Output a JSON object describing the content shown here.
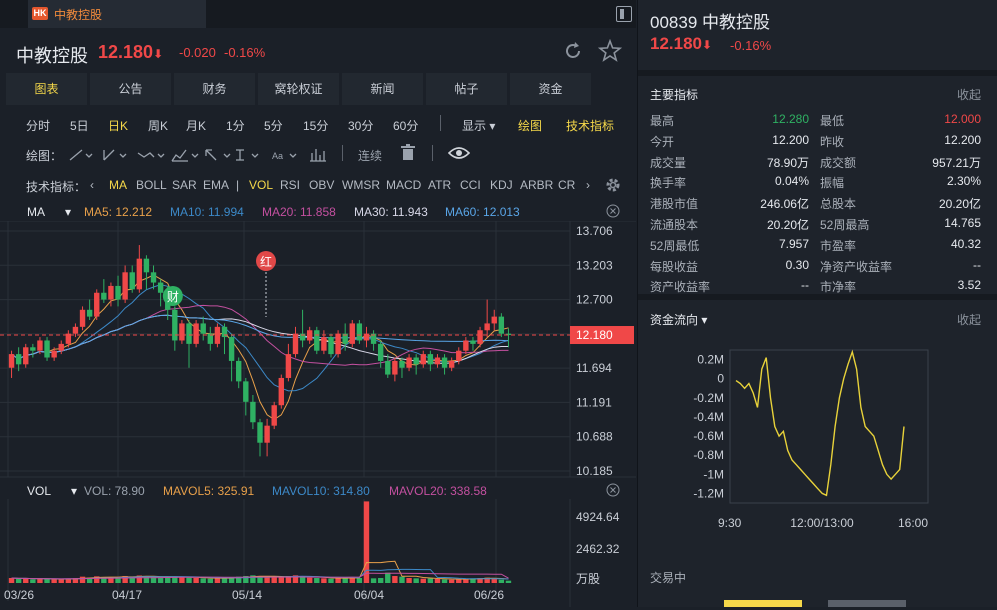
{
  "window": {
    "badge": "HK",
    "tab_title": "中教控股"
  },
  "quote": {
    "name": "中教控股",
    "price": "12.180",
    "arrow": "⬇",
    "change": "-0.020",
    "change_pct": "-0.16%"
  },
  "nav_tabs": [
    "图表",
    "公告",
    "财务",
    "窝轮权证",
    "新闻",
    "帖子",
    "资金"
  ],
  "periods": [
    "分时",
    "5日",
    "日K",
    "周K",
    "月K",
    "1分",
    "5分",
    "15分",
    "30分",
    "60分"
  ],
  "toolbar": {
    "display": "显示",
    "draw": "绘图",
    "tech": "技术指标",
    "draw_label": "绘图：",
    "continuous": "连续"
  },
  "indicators": {
    "label": "技术指标：",
    "items": [
      "MA",
      "BOLL",
      "SAR",
      "EMA",
      "|",
      "VOL",
      "RSI",
      "OBV",
      "WMSR",
      "MACD",
      "ATR",
      "CCI",
      "KDJ",
      "ARBR",
      "CR"
    ]
  },
  "ma_legend": {
    "name": "MA",
    "items": [
      {
        "label": "MA5: 12.212",
        "color": "#e8a04a"
      },
      {
        "label": "MA10: 11.994",
        "color": "#3c89c8"
      },
      {
        "label": "MA20: 11.858",
        "color": "#c450a0"
      },
      {
        "label": "MA30: 11.943",
        "color": "#d8d8e8"
      },
      {
        "label": "MA60: 12.013",
        "color": "#5aa6e8"
      }
    ]
  },
  "price_axis": [
    "13.706",
    "13.203",
    "12.700",
    "12.180",
    "11.694",
    "11.191",
    "10.688",
    "10.185"
  ],
  "vol_legend": {
    "name": "VOL",
    "items": [
      {
        "label": "VOL: 78.90",
        "color": "#9aa2ad"
      },
      {
        "label": "MAVOL5: 325.91",
        "color": "#e8a04a"
      },
      {
        "label": "MAVOL10: 314.80",
        "color": "#3c89c8"
      },
      {
        "label": "MAVOL20: 338.58",
        "color": "#c450a0"
      }
    ]
  },
  "vol_axis": [
    "4924.64",
    "2462.32",
    "万股"
  ],
  "date_axis": [
    "03/26",
    "04/17",
    "05/14",
    "06/04",
    "06/26"
  ],
  "markers": {
    "cai": "财",
    "hong": "红"
  },
  "colors": {
    "up": "#f04848",
    "down": "#2fb163",
    "accent": "#f5d84a"
  },
  "right_panel": {
    "code_name": "00839 中教控股",
    "price": "12.180",
    "arrow": "⬇",
    "change_pct": "-0.16%",
    "metrics_title": "主要指标",
    "collapse": "收起",
    "metrics_left": [
      {
        "label": "最高",
        "value": "12.280",
        "color": "#2fb163"
      },
      {
        "label": "今开",
        "value": "12.200"
      },
      {
        "label": "成交量",
        "value": "78.90万"
      },
      {
        "label": "换手率",
        "value": "0.04%"
      },
      {
        "label": "港股市值",
        "value": "246.06亿"
      },
      {
        "label": "流通股本",
        "value": "20.20亿"
      },
      {
        "label": "52周最低",
        "value": "7.957"
      },
      {
        "label": "每股收益",
        "value": "0.30"
      },
      {
        "label": "资产收益率",
        "value": "--"
      }
    ],
    "metrics_right": [
      {
        "label": "最低",
        "value": "12.000",
        "color": "#f04848"
      },
      {
        "label": "昨收",
        "value": "12.200"
      },
      {
        "label": "成交额",
        "value": "957.21万"
      },
      {
        "label": "振幅",
        "value": "2.30%"
      },
      {
        "label": "总股本",
        "value": "20.20亿"
      },
      {
        "label": "52周最高",
        "value": "14.765"
      },
      {
        "label": "市盈率",
        "value": "40.32"
      },
      {
        "label": "净资产收益率",
        "value": "--"
      },
      {
        "label": "市净率",
        "value": "3.52"
      }
    ],
    "flow_title": "资金流向",
    "flow_yaxis": [
      "0.2M",
      "0",
      "-0.2M",
      "-0.4M",
      "-0.6M",
      "-0.8M",
      "-1M",
      "-1.2M"
    ],
    "flow_xaxis": [
      "9:30",
      "12:00/13:00",
      "16:00"
    ],
    "trading_status": "交易中"
  },
  "chart_data": [
    {
      "type": "candlestick",
      "title": "",
      "x_tick_labels": [
        "03/26",
        "04/17",
        "05/14",
        "06/04",
        "06/26"
      ],
      "ylim": [
        10.185,
        13.706
      ],
      "last_price": 12.18,
      "candles": [
        [
          11.7,
          11.9,
          11.55,
          11.95
        ],
        [
          11.9,
          11.75,
          11.65,
          12.0
        ],
        [
          11.75,
          12.0,
          11.7,
          12.05
        ],
        [
          12.0,
          11.95,
          11.85,
          12.05
        ],
        [
          11.95,
          12.1,
          11.9,
          12.15
        ],
        [
          12.1,
          11.85,
          11.8,
          12.15
        ],
        [
          11.85,
          11.95,
          11.8,
          12.0
        ],
        [
          11.95,
          12.05,
          11.9,
          12.1
        ],
        [
          12.05,
          12.2,
          12.0,
          12.25
        ],
        [
          12.2,
          12.3,
          12.15,
          12.35
        ],
        [
          12.3,
          12.55,
          12.25,
          12.6
        ],
        [
          12.55,
          12.45,
          12.4,
          12.7
        ],
        [
          12.45,
          12.8,
          12.4,
          12.85
        ],
        [
          12.8,
          12.7,
          12.65,
          13.0
        ],
        [
          12.7,
          12.9,
          12.6,
          12.95
        ],
        [
          12.9,
          12.7,
          12.6,
          13.05
        ],
        [
          12.7,
          13.1,
          12.65,
          13.2
        ],
        [
          13.1,
          12.85,
          12.8,
          13.2
        ],
        [
          12.85,
          13.3,
          12.8,
          13.5
        ],
        [
          13.3,
          13.1,
          12.85,
          13.35
        ],
        [
          13.1,
          12.95,
          12.85,
          13.2
        ],
        [
          12.95,
          12.8,
          12.6,
          13.0
        ],
        [
          12.8,
          12.55,
          12.4,
          12.9
        ],
        [
          12.55,
          12.1,
          11.95,
          12.6
        ],
        [
          12.1,
          12.35,
          12.05,
          12.4
        ],
        [
          12.35,
          12.05,
          11.7,
          12.4
        ],
        [
          12.05,
          12.35,
          12.0,
          12.4
        ],
        [
          12.35,
          12.2,
          12.1,
          12.45
        ],
        [
          12.2,
          12.05,
          11.95,
          12.3
        ],
        [
          12.05,
          12.3,
          12.0,
          12.35
        ],
        [
          12.3,
          12.15,
          11.9,
          12.35
        ],
        [
          12.15,
          11.8,
          11.5,
          12.2
        ],
        [
          11.8,
          11.5,
          11.4,
          11.85
        ],
        [
          11.5,
          11.2,
          11.0,
          11.55
        ],
        [
          11.2,
          10.9,
          10.8,
          11.3
        ],
        [
          10.9,
          10.6,
          10.4,
          10.95
        ],
        [
          10.6,
          10.85,
          10.4,
          10.95
        ],
        [
          10.85,
          11.15,
          10.8,
          11.2
        ],
        [
          11.15,
          11.55,
          11.1,
          11.6
        ],
        [
          11.55,
          11.9,
          11.5,
          12.05
        ],
        [
          11.9,
          12.2,
          11.85,
          12.3
        ],
        [
          12.2,
          12.1,
          12.0,
          12.55
        ],
        [
          12.1,
          12.25,
          12.05,
          12.3
        ],
        [
          12.25,
          11.95,
          11.9,
          12.3
        ],
        [
          11.95,
          12.15,
          11.9,
          12.25
        ],
        [
          12.15,
          11.9,
          11.85,
          12.2
        ],
        [
          11.9,
          12.2,
          11.85,
          12.25
        ],
        [
          12.2,
          12.05,
          11.95,
          12.35
        ],
        [
          12.05,
          12.35,
          12.0,
          12.4
        ],
        [
          12.35,
          12.1,
          12.05,
          12.4
        ],
        [
          12.1,
          12.2,
          12.0,
          12.3
        ],
        [
          12.2,
          12.05,
          11.95,
          12.25
        ],
        [
          12.05,
          11.8,
          11.7,
          12.1
        ],
        [
          11.8,
          11.6,
          11.55,
          11.9
        ],
        [
          11.6,
          11.8,
          11.5,
          11.85
        ],
        [
          11.8,
          11.7,
          11.55,
          11.85
        ],
        [
          11.7,
          11.85,
          11.65,
          11.9
        ],
        [
          11.85,
          11.75,
          11.6,
          11.9
        ],
        [
          11.75,
          11.9,
          11.7,
          11.95
        ],
        [
          11.9,
          11.75,
          11.65,
          11.95
        ],
        [
          11.75,
          11.85,
          11.7,
          11.9
        ],
        [
          11.85,
          11.7,
          11.6,
          11.9
        ],
        [
          11.7,
          11.8,
          11.65,
          11.85
        ],
        [
          11.8,
          11.95,
          11.75,
          12.0
        ],
        [
          11.95,
          12.1,
          11.9,
          12.15
        ],
        [
          12.1,
          12.05,
          11.95,
          12.15
        ],
        [
          12.05,
          12.25,
          12.0,
          12.3
        ],
        [
          12.25,
          12.35,
          12.15,
          12.7
        ],
        [
          12.35,
          12.45,
          12.25,
          12.55
        ],
        [
          12.45,
          12.2,
          12.15,
          12.5
        ],
        [
          12.2,
          12.18,
          12.0,
          12.28
        ]
      ]
    },
    {
      "type": "bar",
      "title": "",
      "ylim": [
        0,
        4924.64
      ],
      "values": [
        300,
        250,
        280,
        220,
        260,
        240,
        210,
        230,
        260,
        300,
        380,
        320,
        400,
        350,
        330,
        360,
        420,
        380,
        450,
        400,
        360,
        340,
        380,
        400,
        330,
        320,
        300,
        280,
        260,
        300,
        280,
        340,
        380,
        420,
        460,
        400,
        380,
        360,
        340,
        420,
        460,
        380,
        320,
        300,
        280,
        260,
        300,
        320,
        340,
        300,
        4900,
        280,
        300,
        620,
        420,
        380,
        300,
        280,
        260,
        280,
        240,
        220,
        200,
        240,
        260,
        280,
        300,
        320,
        240,
        200,
        140
      ],
      "up_flags": [
        1,
        0,
        1,
        0,
        1,
        0,
        1,
        1,
        1,
        1,
        1,
        0,
        1,
        0,
        1,
        0,
        1,
        0,
        1,
        0,
        0,
        0,
        0,
        0,
        1,
        0,
        1,
        0,
        0,
        1,
        0,
        0,
        0,
        0,
        0,
        0,
        1,
        1,
        1,
        1,
        1,
        0,
        1,
        0,
        1,
        0,
        1,
        0,
        1,
        0,
        1,
        0,
        0,
        0,
        1,
        0,
        1,
        0,
        1,
        0,
        1,
        0,
        1,
        1,
        1,
        0,
        1,
        1,
        1,
        0,
        0
      ]
    },
    {
      "type": "line",
      "title": "",
      "xlabel": "",
      "ylabel": "",
      "x_tick_labels": [
        "9:30",
        "12:00/13:00",
        "16:00"
      ],
      "ylim": [
        -1.2,
        0.2
      ],
      "unit": "M",
      "values": [
        -0.02,
        -0.05,
        -0.1,
        -0.05,
        -0.15,
        -0.3,
        0.1,
        0.22,
        -0.2,
        -0.5,
        -0.6,
        -0.55,
        -0.75,
        -0.85,
        -0.9,
        -0.95,
        -1.0,
        -1.05,
        -1.1,
        -1.15,
        -1.2,
        -1.22,
        -0.9,
        -0.5,
        -0.2,
        0.0,
        0.15,
        0.28,
        0.1,
        -0.3,
        -0.5,
        -0.55,
        -0.6,
        -0.75,
        -0.9,
        -1.0,
        -1.05,
        -1.0,
        -0.95,
        -0.5
      ]
    }
  ]
}
